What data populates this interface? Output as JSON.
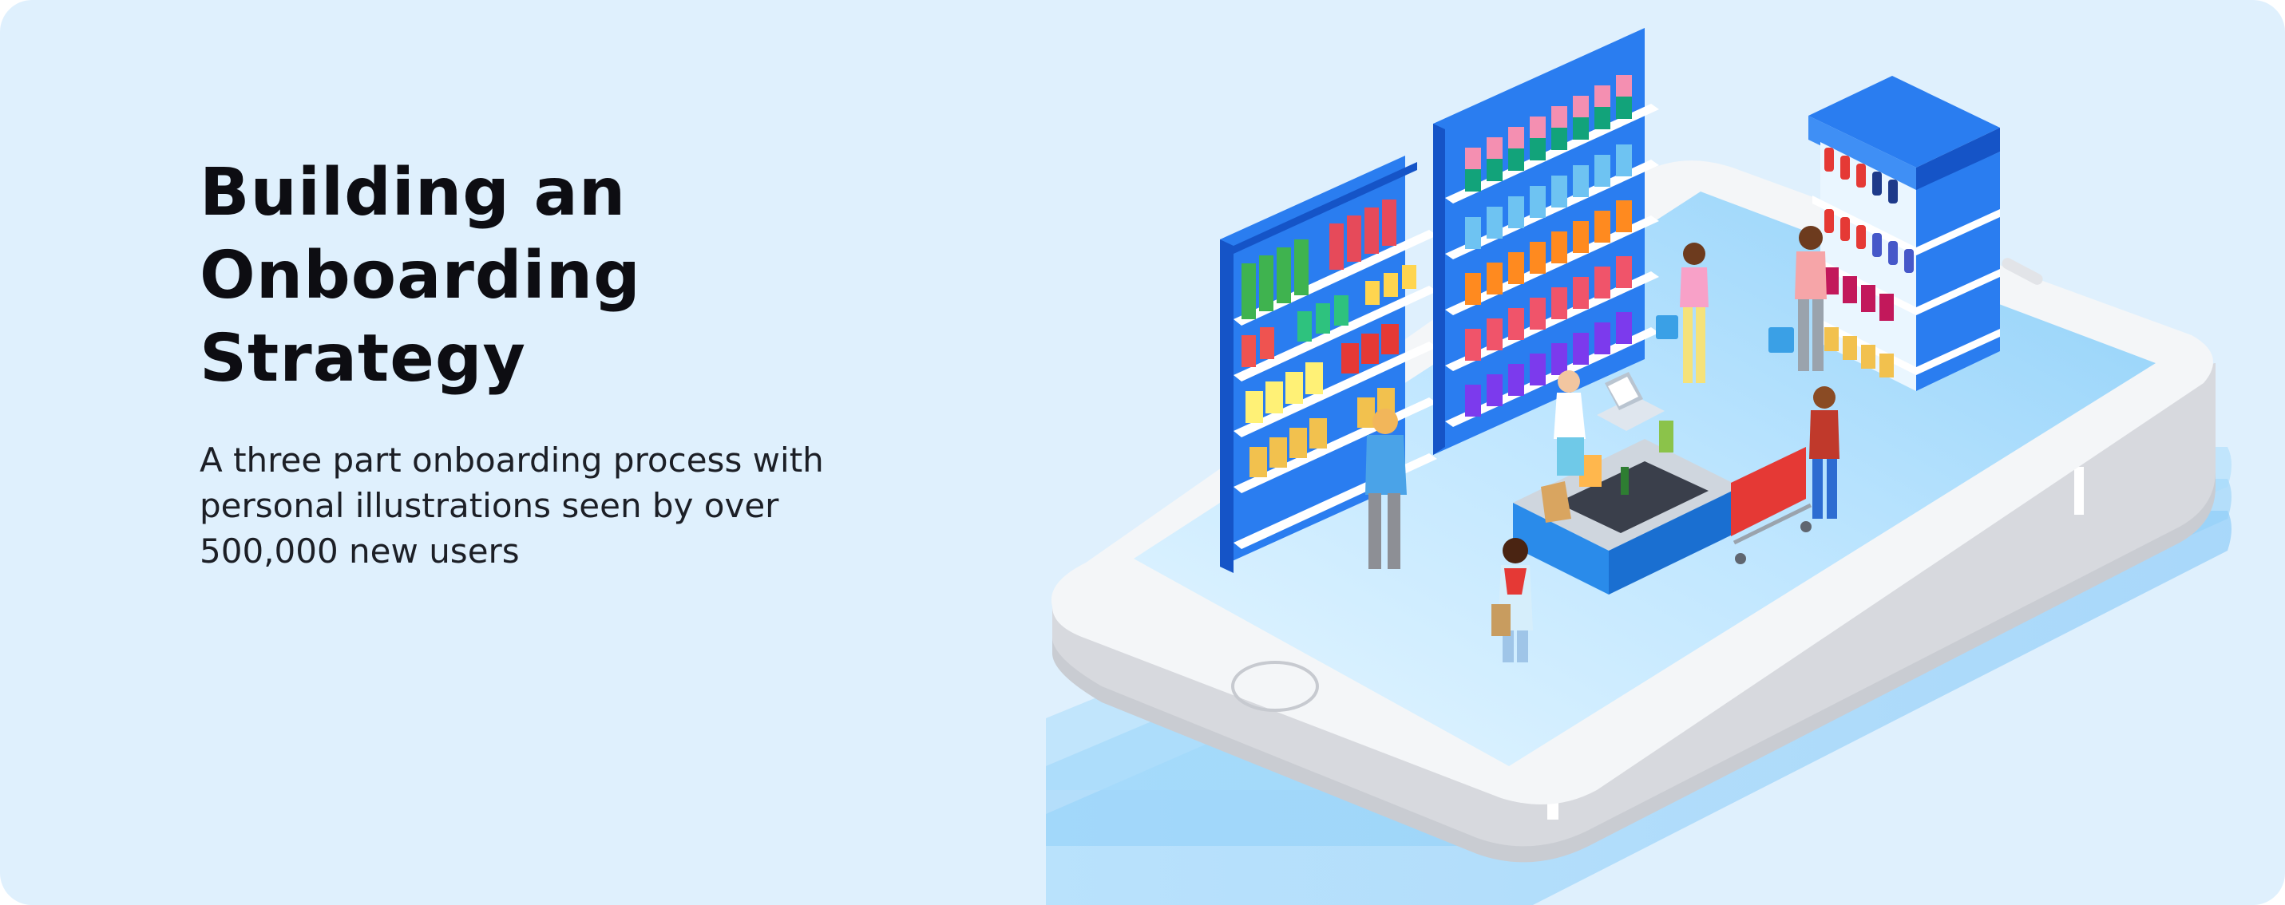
{
  "hero": {
    "title_lines": [
      "Building an",
      "Onboarding",
      "Strategy"
    ],
    "subtitle_lines": [
      "A three part onboarding process with",
      "personal illustrations seen by over",
      "500,000 new users"
    ]
  },
  "illustration": {
    "subject": "isometric-smartphone-supermarket",
    "icons": [
      "smartphone-icon",
      "home-button-icon",
      "shelf-icon",
      "checkout-counter-icon",
      "cash-register-icon",
      "shopping-cart-icon",
      "shopping-basket-icon",
      "shopping-bag-icon",
      "shopper-icon"
    ]
  },
  "colors": {
    "background": "#dff0fd",
    "text": "#0d0d12",
    "shelf_blue": "#2a7df0",
    "shelf_dark": "#1554c7",
    "screen_light": "#c9ecff",
    "cart_red": "#e53935",
    "phone_body": "#f4f6f8"
  }
}
